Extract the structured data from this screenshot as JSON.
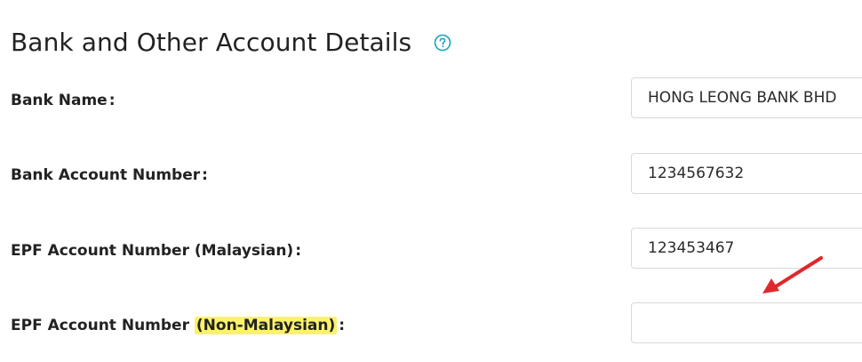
{
  "section": {
    "title": "Bank and Other Account Details",
    "help_icon": "question-circle-icon"
  },
  "fields": [
    {
      "label": "Bank Name",
      "colon": ":",
      "value": "HONG LEONG BANK BHD"
    },
    {
      "label": "Bank Account Number",
      "colon": ":",
      "value": "1234567632"
    },
    {
      "label": "EPF Account Number (Malaysian)",
      "colon": ":",
      "value": "123453467"
    },
    {
      "label_prefix": "EPF Account Number ",
      "label_highlight": "(Non-Malaysian)",
      "colon": ":",
      "value": ""
    }
  ],
  "annotation": {
    "arrow_color": "#e0282c",
    "highlight_color": "#fbf26c"
  }
}
